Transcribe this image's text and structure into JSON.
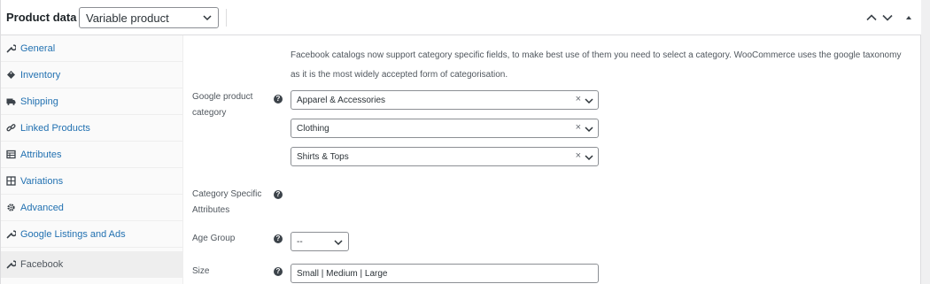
{
  "header": {
    "title": "Product data",
    "dash": "—",
    "product_type": "Variable product",
    "move_up_icon": "chevron-up",
    "move_down_icon": "chevron-down",
    "toggle_icon": "triangle-up"
  },
  "sidebar": {
    "items": [
      {
        "label": "General",
        "icon": "wrench-icon"
      },
      {
        "label": "Inventory",
        "icon": "tag-icon"
      },
      {
        "label": "Shipping",
        "icon": "truck-icon"
      },
      {
        "label": "Linked Products",
        "icon": "link-icon"
      },
      {
        "label": "Attributes",
        "icon": "table-icon"
      },
      {
        "label": "Variations",
        "icon": "grid-icon"
      },
      {
        "label": "Advanced",
        "icon": "gear-icon"
      },
      {
        "label": "Google Listings and Ads",
        "icon": "wrench-icon"
      },
      {
        "label": "Facebook",
        "icon": "wrench-icon",
        "active": true
      }
    ]
  },
  "main": {
    "notice": "Facebook catalogs now support category specific fields, to make best use of them you need to select a category. WooCommerce uses the google taxonomy as it is the most widely accepted form of categorisation.",
    "google_category": {
      "label": "Google product category",
      "levels": [
        "Apparel & Accessories",
        "Clothing",
        "Shirts & Tops"
      ],
      "clear_glyph": "×"
    },
    "category_specific": {
      "label": "Category Specific Attributes"
    },
    "age_group": {
      "label": "Age Group",
      "value": "--"
    },
    "size": {
      "label": "Size",
      "value": "Small | Medium | Large"
    },
    "help_glyph": "?"
  }
}
